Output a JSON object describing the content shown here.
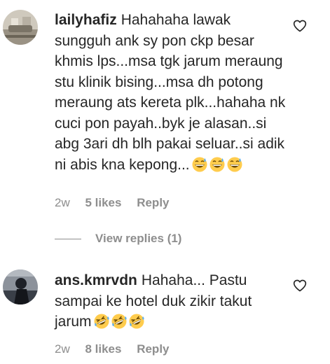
{
  "comments": [
    {
      "username": "lailyhafiz",
      "text": "Hahahaha lawak sungguh ank sy pon ckp besar khmis lps...msa tgk jarum meraung stu klinik bising...msa dh potong meraung ats kereta plk...hahaha nk cuci pon payah..byk je alasan..si abg 3ari dh blh pakai seluar..si adik ni abis kna kepong...",
      "emoji": [
        "grinning-sweat-emoji",
        "grinning-sweat-emoji",
        "grinning-sweat-emoji"
      ],
      "time": "2w",
      "likes": "5 likes",
      "reply": "Reply",
      "view_replies": "View replies (1)"
    },
    {
      "username": "ans.kmrvdn",
      "text": "Hahaha... Pastu sampai ke hotel duk zikir takut jarum",
      "emoji": [
        "rolling-laughing-emoji",
        "rolling-laughing-emoji",
        "rolling-laughing-emoji"
      ],
      "time": "2w",
      "likes": "8 likes",
      "reply": "Reply"
    }
  ],
  "colors": {
    "text": "#262626",
    "secondary": "#8e8e8e",
    "emoji_face": "#FFCC4D",
    "emoji_sweat": "#5DADEC"
  }
}
